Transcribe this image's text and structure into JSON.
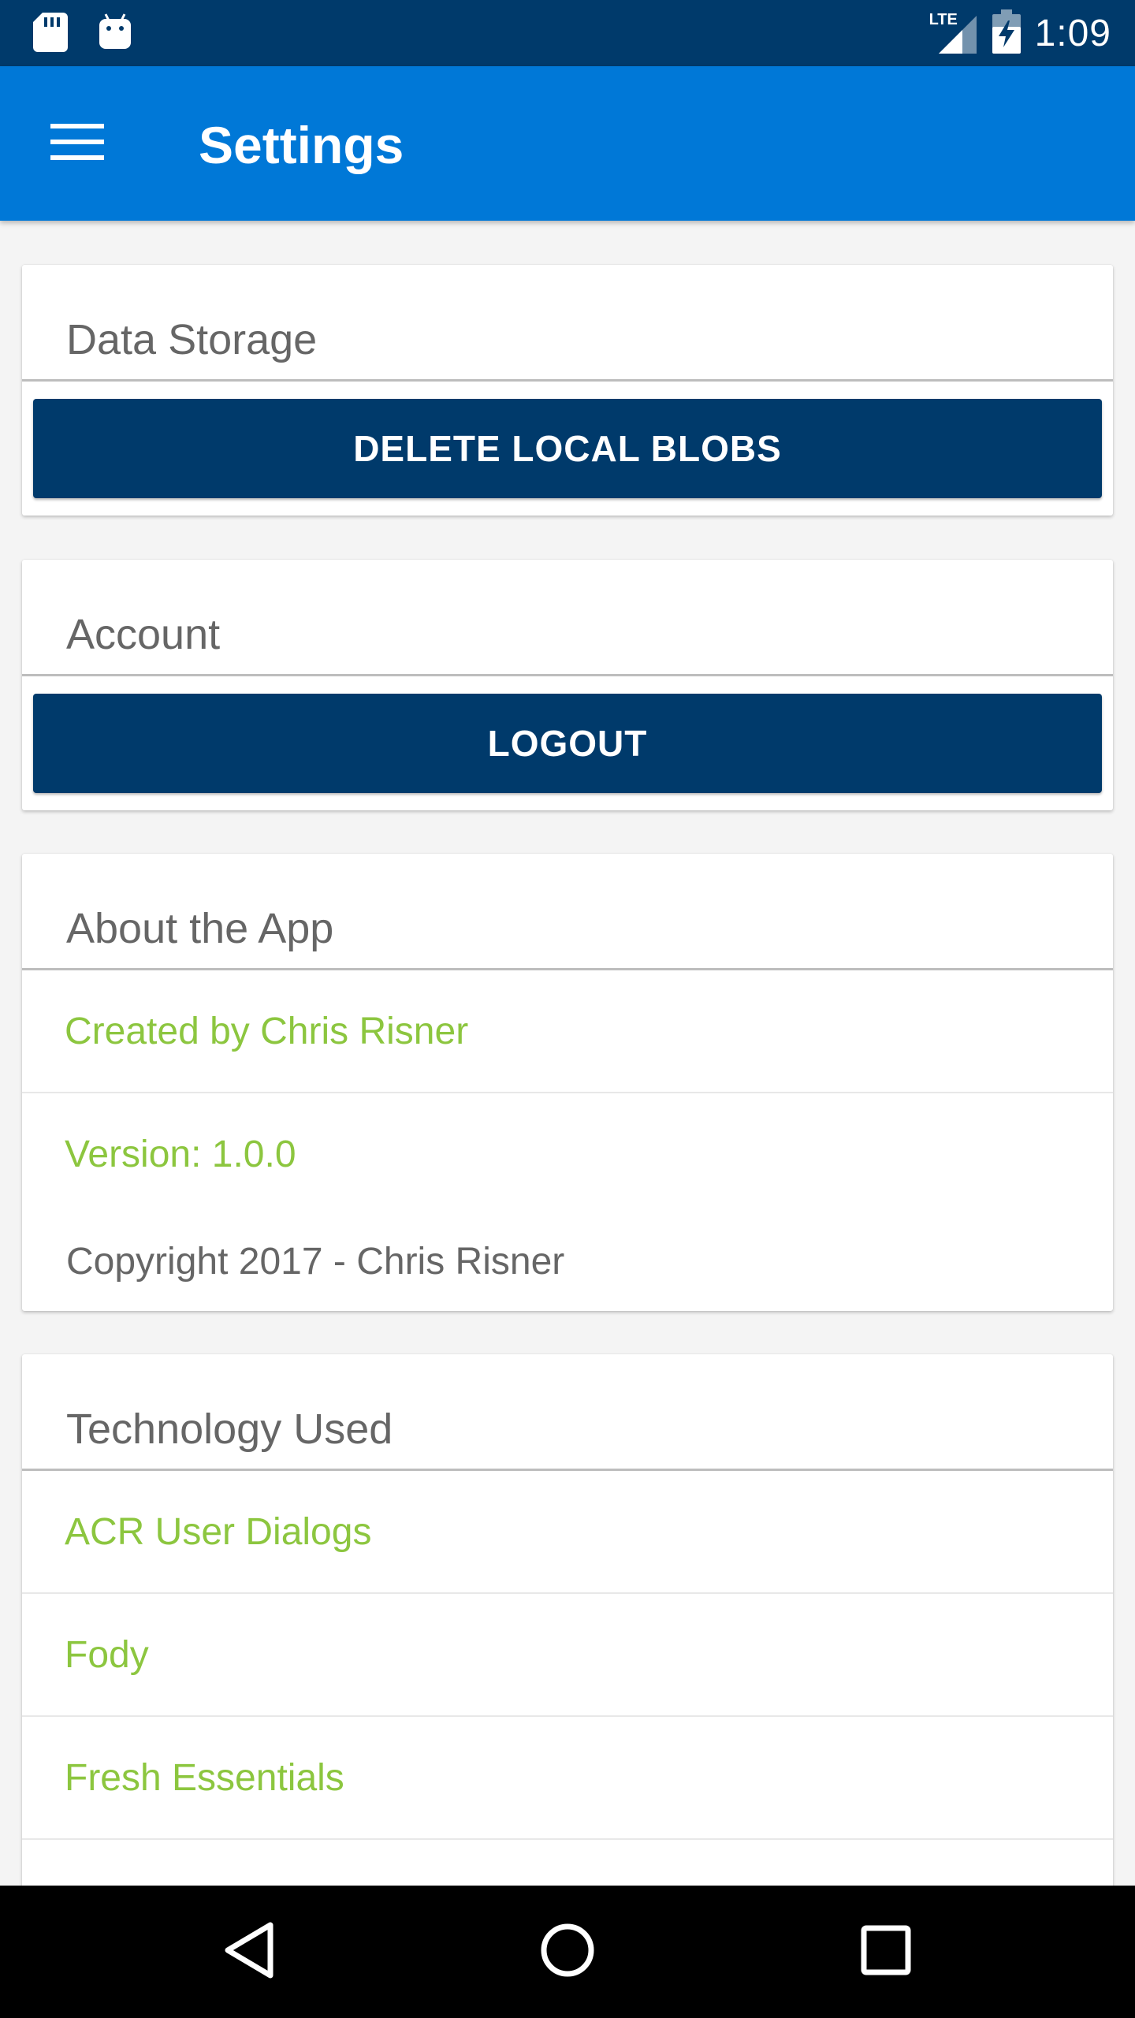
{
  "status_bar": {
    "time": "1:09",
    "network_label": "LTE",
    "icons": [
      "sd-card-icon",
      "android-icon",
      "signal-icon",
      "battery-charging-icon"
    ]
  },
  "app_bar": {
    "title": "Settings",
    "menu_icon": "hamburger-menu-icon"
  },
  "data_storage": {
    "title": "Data Storage",
    "button_label": "DELETE LOCAL BLOBS"
  },
  "account": {
    "title": "Account",
    "button_label": "LOGOUT"
  },
  "about": {
    "title": "About the App",
    "items": [
      {
        "label": "Created by Chris Risner"
      },
      {
        "label": "Version: 1.0.0"
      }
    ],
    "copyright": "Copyright 2017 - Chris Risner"
  },
  "technology": {
    "title": "Technology Used",
    "items": [
      {
        "label": "ACR User Dialogs"
      },
      {
        "label": "Fody"
      },
      {
        "label": "Fresh Essentials"
      }
    ]
  },
  "nav_bar": {
    "icons": [
      "back-icon",
      "home-icon",
      "recents-icon"
    ]
  },
  "colors": {
    "status_bar": "#003a6b",
    "app_bar": "#0078d7",
    "button": "#003a6b",
    "link_text": "#8cc63f",
    "background": "#f4f4f4"
  }
}
